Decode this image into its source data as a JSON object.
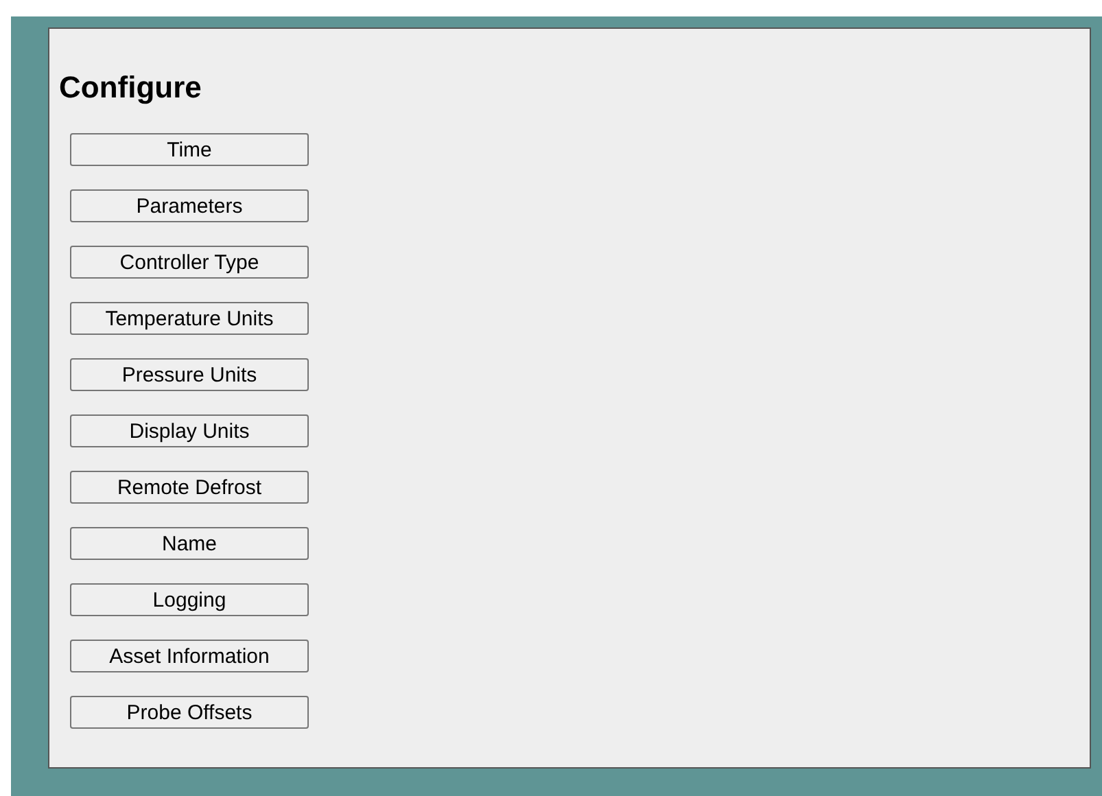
{
  "heading": "Configure",
  "buttons": [
    "Time",
    "Parameters",
    "Controller Type",
    "Temperature Units",
    "Pressure Units",
    "Display Units",
    "Remote Defrost",
    "Name",
    "Logging",
    "Asset Information",
    "Probe Offsets"
  ]
}
